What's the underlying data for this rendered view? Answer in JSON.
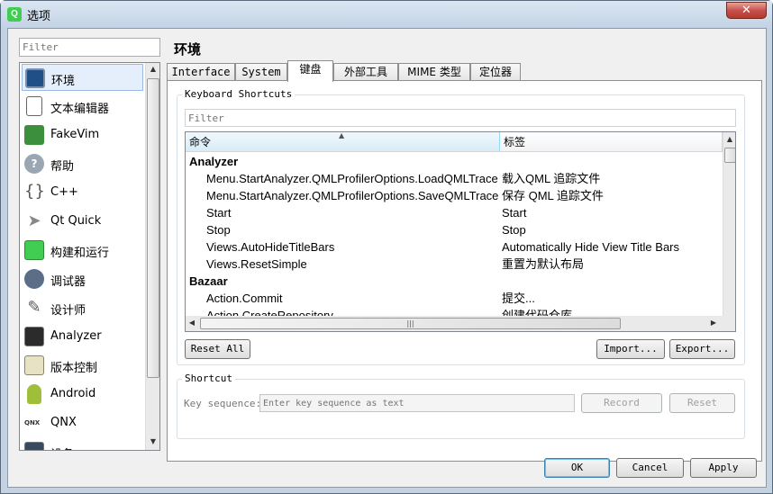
{
  "window": {
    "title": "选项",
    "app_icon": "qt-creator-icon",
    "close_glyph": "✕"
  },
  "sidebar": {
    "filter_placeholder": "Filter",
    "items": [
      {
        "label": "环境",
        "icon": "environment-icon",
        "selected": true
      },
      {
        "label": "文本编辑器",
        "icon": "text-editor-icon"
      },
      {
        "label": "FakeVim",
        "icon": "fakevim-icon"
      },
      {
        "label": "帮助",
        "icon": "help-icon"
      },
      {
        "label": "C++",
        "icon": "cpp-icon"
      },
      {
        "label": "Qt Quick",
        "icon": "qt-quick-icon"
      },
      {
        "label": "构建和运行",
        "icon": "build-run-icon"
      },
      {
        "label": "调试器",
        "icon": "debugger-icon"
      },
      {
        "label": "设计师",
        "icon": "designer-icon"
      },
      {
        "label": "Analyzer",
        "icon": "analyzer-icon"
      },
      {
        "label": "版本控制",
        "icon": "version-control-icon"
      },
      {
        "label": "Android",
        "icon": "android-icon"
      },
      {
        "label": "QNX",
        "icon": "qnx-icon"
      },
      {
        "label": "设备",
        "icon": "devices-icon"
      }
    ]
  },
  "page": {
    "title": "环境"
  },
  "tabs": [
    {
      "label": "Interface"
    },
    {
      "label": "System"
    },
    {
      "label": "键盘",
      "selected": true
    },
    {
      "label": "外部工具"
    },
    {
      "label": "MIME 类型"
    },
    {
      "label": "定位器"
    }
  ],
  "keyboard_shortcuts": {
    "group_title": "Keyboard Shortcuts",
    "filter_placeholder": "Filter",
    "columns": {
      "command": "命令",
      "label": "标签"
    },
    "rows": [
      {
        "command": "Analyzer",
        "label": "",
        "group": true
      },
      {
        "command": "Menu.StartAnalyzer.QMLProfilerOptions.LoadQMLTrace",
        "label": "载入QML 追踪文件"
      },
      {
        "command": "Menu.StartAnalyzer.QMLProfilerOptions.SaveQMLTrace",
        "label": "保存 QML 追踪文件"
      },
      {
        "command": "Start",
        "label": "Start"
      },
      {
        "command": "Stop",
        "label": "Stop"
      },
      {
        "command": "Views.AutoHideTitleBars",
        "label": "Automatically Hide View Title Bars"
      },
      {
        "command": "Views.ResetSimple",
        "label": "重置为默认布局"
      },
      {
        "command": "Bazaar",
        "label": "",
        "group": true
      },
      {
        "command": "Action.Commit",
        "label": "提交..."
      },
      {
        "command": "Action.CreateRepository",
        "label": "创建代码仓库..."
      }
    ],
    "reset_all": "Reset All",
    "import": "Import...",
    "export": "Export..."
  },
  "shortcut": {
    "group_title": "Shortcut",
    "key_sequence_label": "Key sequence:",
    "key_sequence_placeholder": "Enter key sequence as text",
    "record": "Record",
    "reset": "Reset"
  },
  "dialog_buttons": {
    "ok": "OK",
    "cancel": "Cancel",
    "apply": "Apply"
  }
}
